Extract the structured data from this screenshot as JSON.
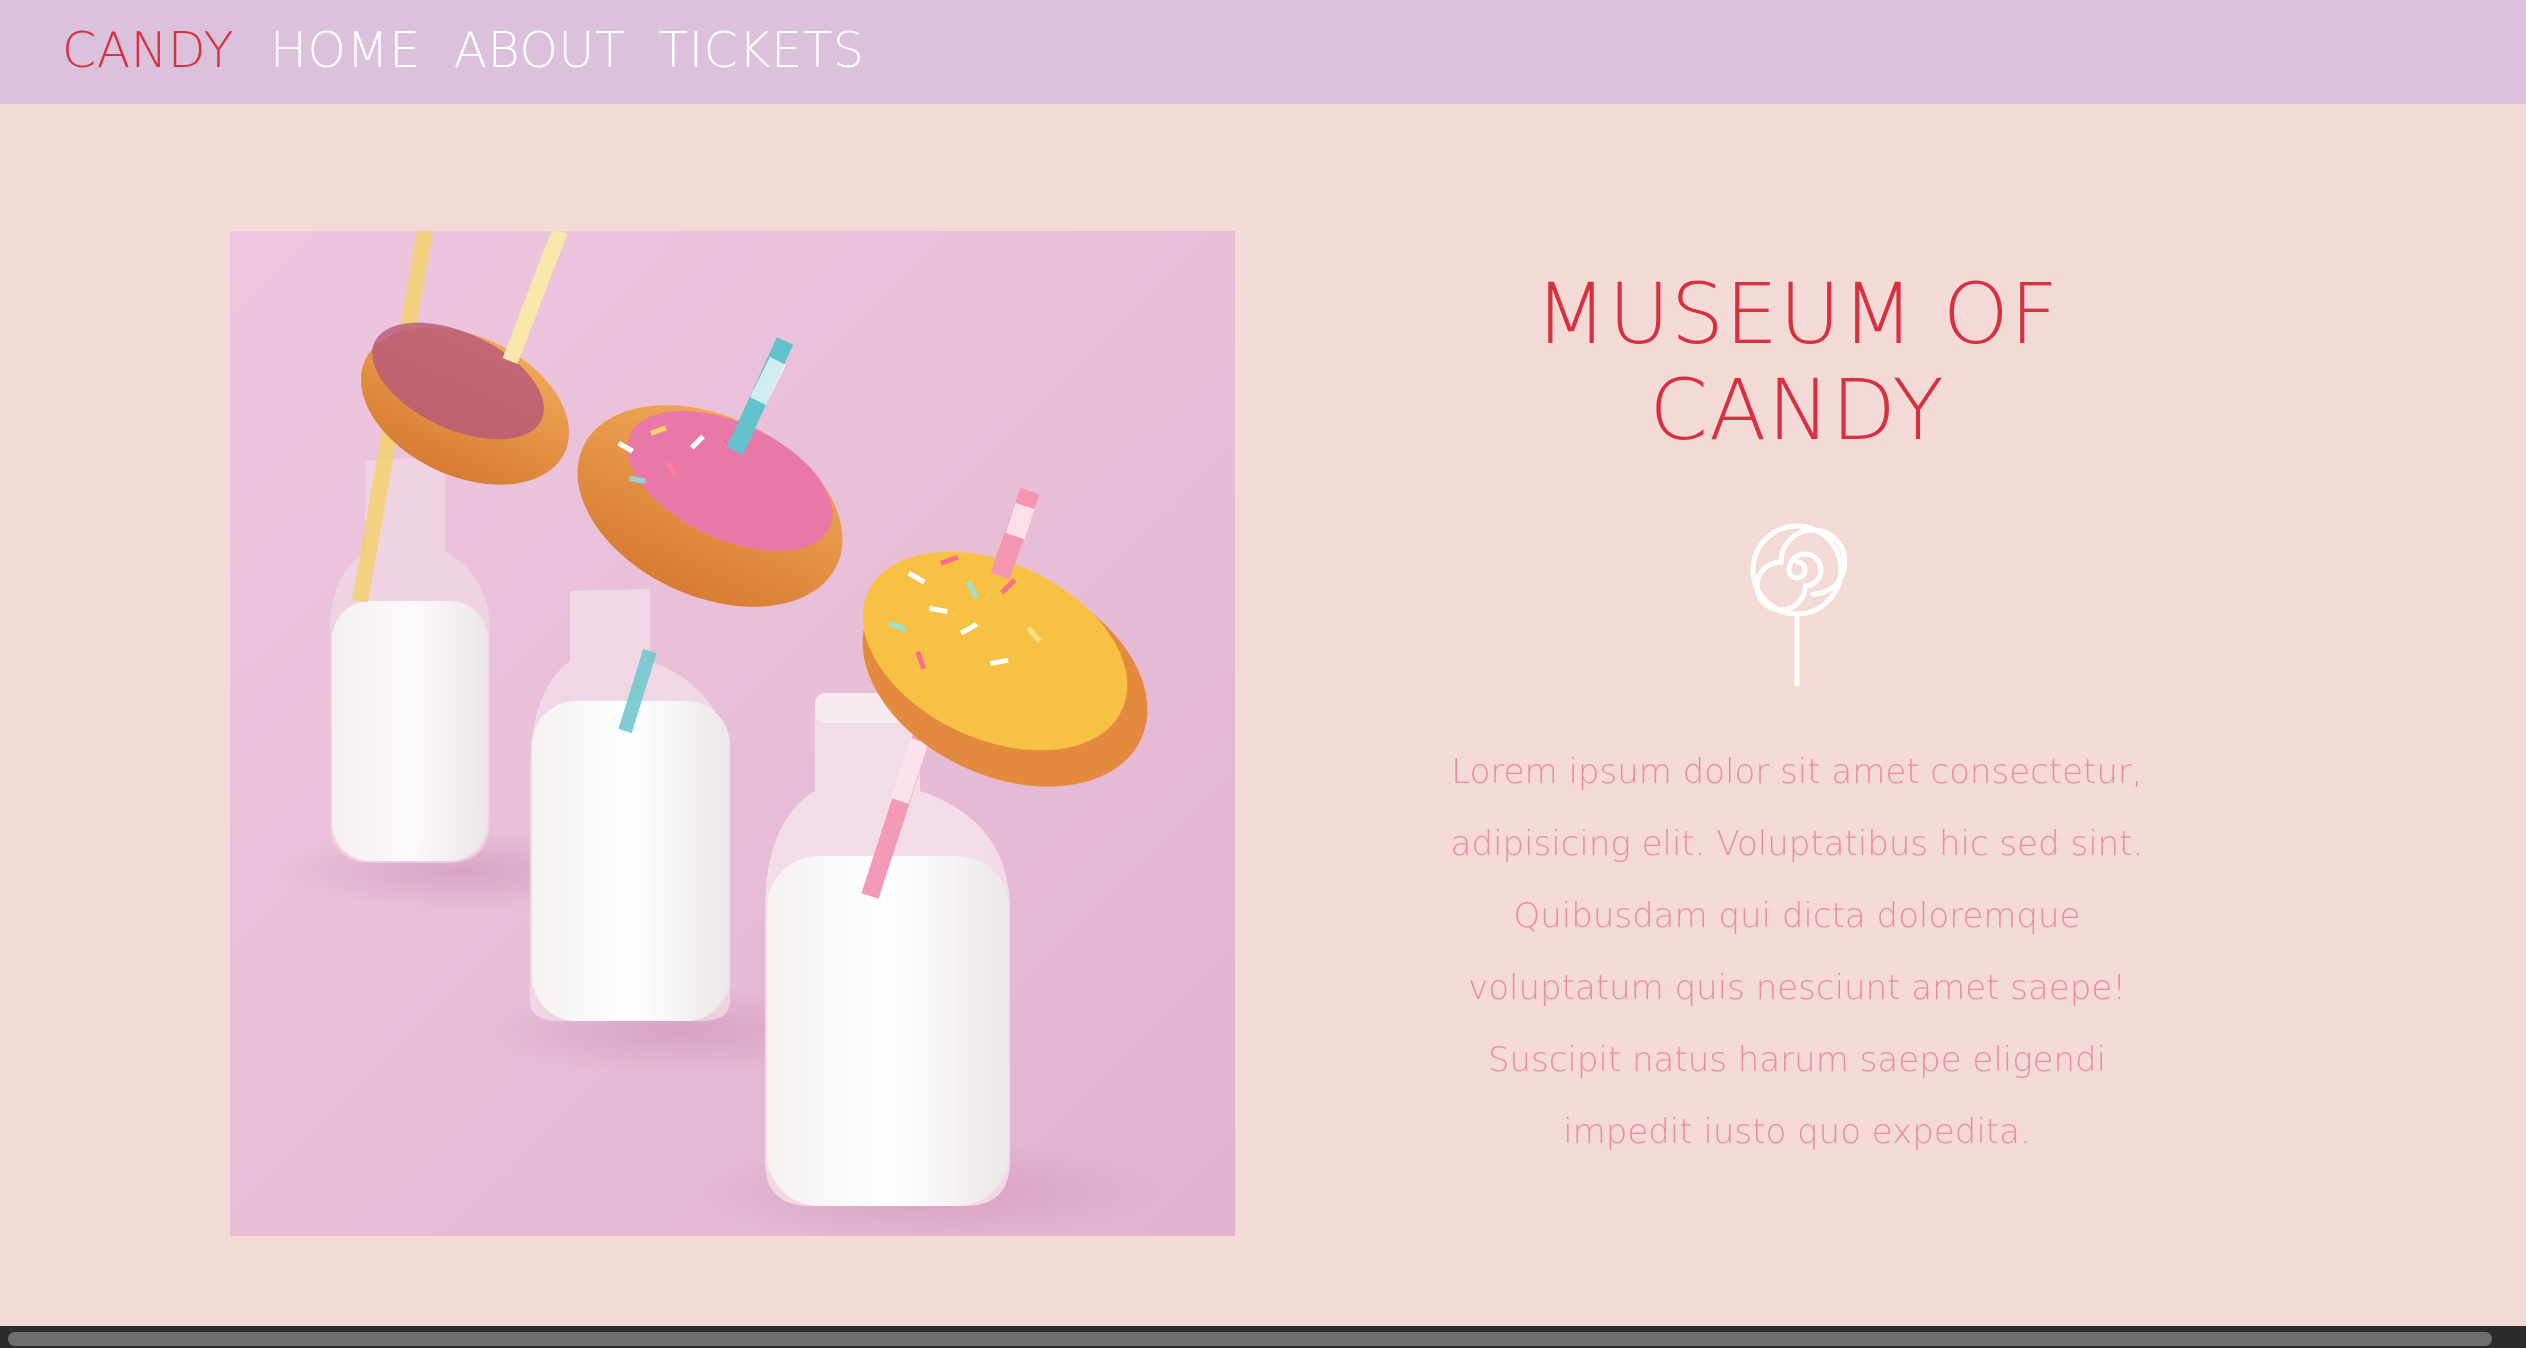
{
  "nav": {
    "brand": "CANDY",
    "links": [
      "HOME",
      "ABOUT",
      "TICKETS"
    ]
  },
  "hero": {
    "image_alt": "milk bottles with donuts and paper straws",
    "title_line1": "MUSEUM OF",
    "title_line2": "CANDY",
    "icon": "lollipop-icon",
    "body_lines": [
      "Lorem ipsum dolor sit amet consectetur,",
      "adipisicing elit. Voluptatibus hic sed sint.",
      "Quibusdam qui dicta doloremque",
      "voluptatum quis nesciunt amet saepe!",
      "Suscipit natus harum saepe eligendi",
      "impedit iusto quo expedita."
    ]
  },
  "colors": {
    "page_background": "#f3dad6",
    "nav_background": "#dcc1dd",
    "brand": "#d8303f",
    "nav_link": "#ffffff",
    "title": "#d8303f",
    "body_text": "#ea8ba6"
  }
}
